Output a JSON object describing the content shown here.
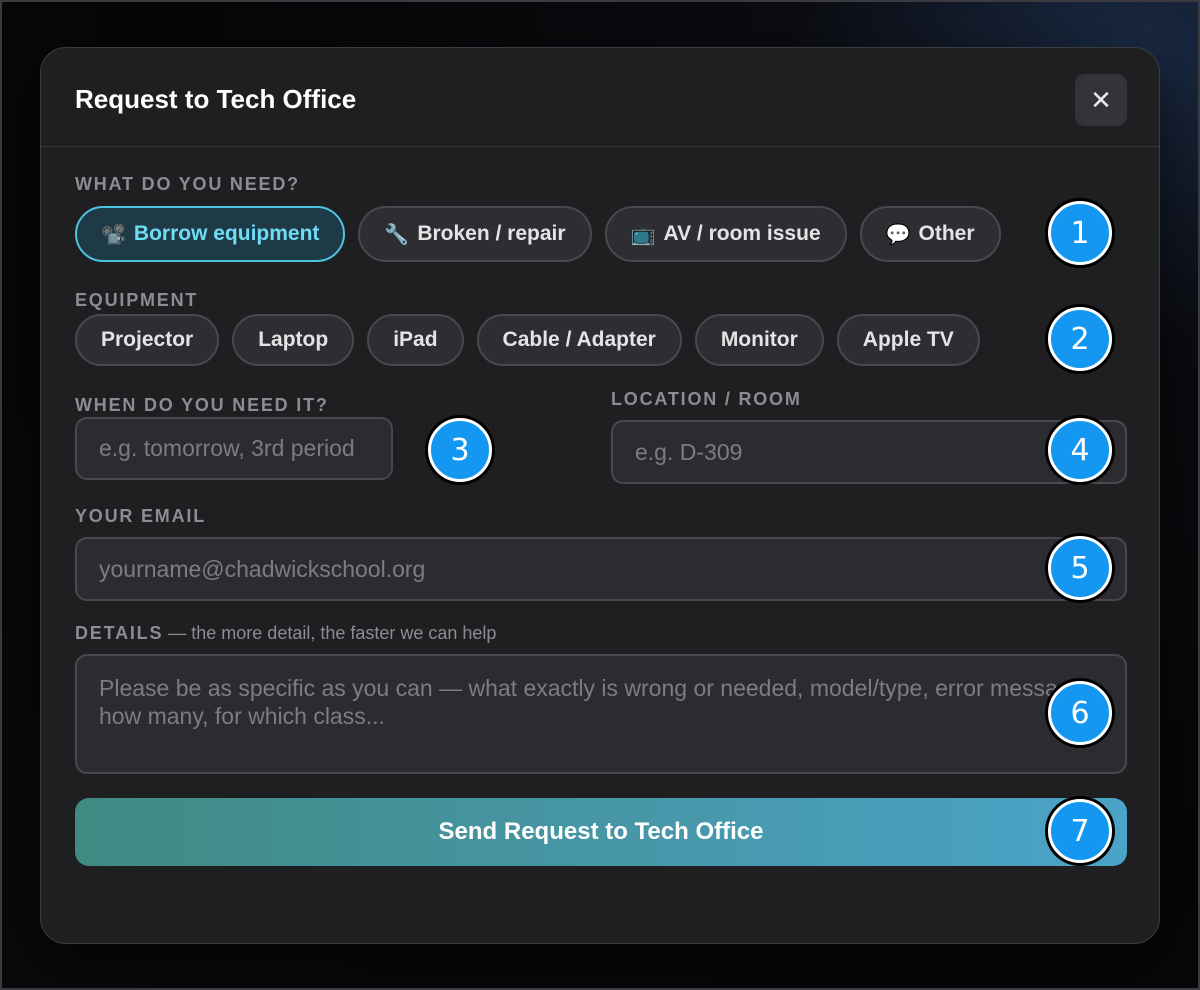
{
  "modal": {
    "title": "Request to Tech Office",
    "close_label": "✕"
  },
  "need": {
    "label": "WHAT DO YOU NEED?",
    "options": [
      {
        "icon": "📽️",
        "icon_name": "projector-icon",
        "label": "Borrow equipment",
        "selected": true
      },
      {
        "icon": "🔧",
        "icon_name": "wrench-icon",
        "label": "Broken / repair",
        "selected": false
      },
      {
        "icon": "📺",
        "icon_name": "tv-icon",
        "label": "AV / room issue",
        "selected": false
      },
      {
        "icon": "💬",
        "icon_name": "speech-bubble-icon",
        "label": "Other",
        "selected": false
      }
    ]
  },
  "equipment": {
    "label": "EQUIPMENT",
    "options": [
      "Projector",
      "Laptop",
      "iPad",
      "Cable / Adapter",
      "Monitor",
      "Apple TV"
    ]
  },
  "when": {
    "label": "WHEN DO YOU NEED IT?",
    "placeholder": "e.g. tomorrow, 3rd period"
  },
  "location": {
    "label": "LOCATION / ROOM",
    "placeholder": "e.g. D-309"
  },
  "email": {
    "label": "YOUR EMAIL",
    "placeholder": "yourname@chadwickschool.org"
  },
  "details": {
    "label": "DETAILS",
    "sublabel": " — the more detail, the faster we can help",
    "placeholder": "Please be as specific as you can — what exactly is wrong or needed, model/type, error messages, how many, for which class..."
  },
  "submit": {
    "label": "Send Request to Tech Office"
  },
  "badges": [
    "1",
    "2",
    "3",
    "4",
    "5",
    "6",
    "7"
  ],
  "colors": {
    "accent": "#4ec3e0",
    "badge": "#1497f0",
    "modal_bg": "#1f1f22"
  }
}
